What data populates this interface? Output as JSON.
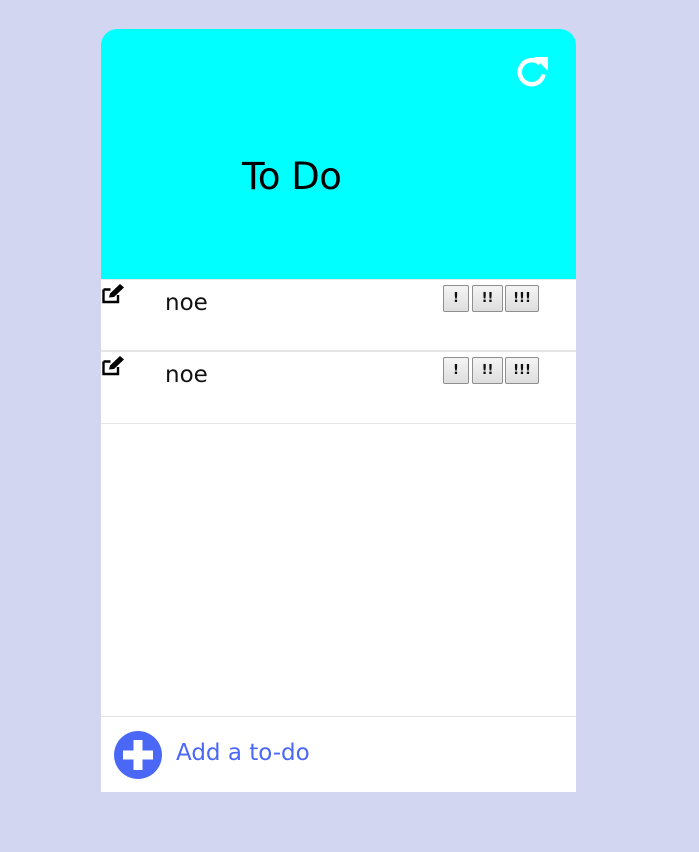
{
  "header": {
    "title": "To Do",
    "refresh_icon": "refresh-icon",
    "background_color": "#00ffff"
  },
  "todos": [
    {
      "text": "noe",
      "edit_icon": "edit-icon",
      "priority_buttons": [
        "!",
        "!!",
        "!!!"
      ]
    },
    {
      "text": "noe",
      "edit_icon": "edit-icon",
      "priority_buttons": [
        "!",
        "!!",
        "!!!"
      ]
    }
  ],
  "footer": {
    "add_label": "Add a to-do",
    "add_icon": "plus-icon",
    "accent_color": "#4a68f5"
  },
  "page_background": "#d3d6f0"
}
